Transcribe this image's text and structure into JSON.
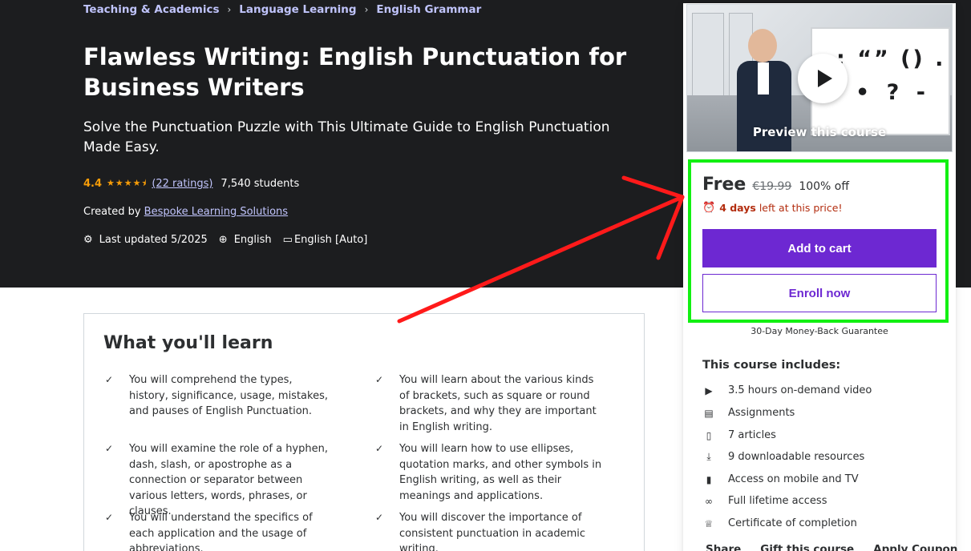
{
  "breadcrumb": [
    "Teaching & Academics",
    "Language Learning",
    "English Grammar"
  ],
  "course": {
    "title": "Flawless Writing: English Punctuation for Business Writers",
    "subtitle": "Solve the Punctuation Puzzle with This Ultimate Guide to English Punctuation Made Easy.",
    "rating": "4.4",
    "stars": "★★★★⯨",
    "ratings_count": "(22 ratings)",
    "students": "7,540 students",
    "created_prefix": "Created by",
    "author": "Bespoke Learning Solutions",
    "last_updated": "Last updated 5/2025",
    "language": "English",
    "captions": "English [Auto]"
  },
  "learn": {
    "title": "What you'll learn",
    "items": [
      "You will comprehend the types, history, significance, usage, mistakes, and pauses of English Punctuation.",
      "You will learn about the various kinds of brackets, such as square or round brackets, and why they are important in English writing.",
      "You will examine the role of a hyphen, dash, slash, or apostrophe as a connection or separator between various letters, words, phrases, or clauses.",
      "You will learn how to use ellipses, quotation marks, and other symbols in English writing, as well as their meanings and applications.",
      "You will understand the specifics of each application and the usage of abbreviations.",
      "You will discover the importance of consistent punctuation in academic writing."
    ]
  },
  "sidebar": {
    "preview_label": "Preview this course",
    "board_line1": ": “” () . ,",
    "board_line2": "• ? -",
    "price_free": "Free",
    "price_old": "€19.99",
    "price_off": "100% off",
    "timer_bold": "4 days",
    "timer_text": "left at this price!",
    "add_to_cart": "Add to cart",
    "enroll_now": "Enroll now",
    "guarantee": "30-Day Money-Back Guarantee",
    "includes_title": "This course includes:",
    "includes": [
      {
        "icon": "video-icon",
        "glyph": "▶",
        "label": "3.5 hours on-demand video"
      },
      {
        "icon": "assignment-icon",
        "glyph": "▤",
        "label": "Assignments"
      },
      {
        "icon": "article-icon",
        "glyph": "▯",
        "label": "7 articles"
      },
      {
        "icon": "download-icon",
        "glyph": "⤓",
        "label": "9 downloadable resources"
      },
      {
        "icon": "mobile-icon",
        "glyph": "▮",
        "label": "Access on mobile and TV"
      },
      {
        "icon": "infinity-icon",
        "glyph": "∞",
        "label": "Full lifetime access"
      },
      {
        "icon": "trophy-icon",
        "glyph": "♕",
        "label": "Certificate of completion"
      }
    ],
    "links": [
      "Share",
      "Gift this course",
      "Apply Coupon"
    ]
  },
  "colors": {
    "hero_bg": "#1c1d1f",
    "accent_purple": "#6d28d2",
    "rating_orange": "#f69c08",
    "annotation_green": "#12f012",
    "annotation_red": "#ff1a1a"
  }
}
